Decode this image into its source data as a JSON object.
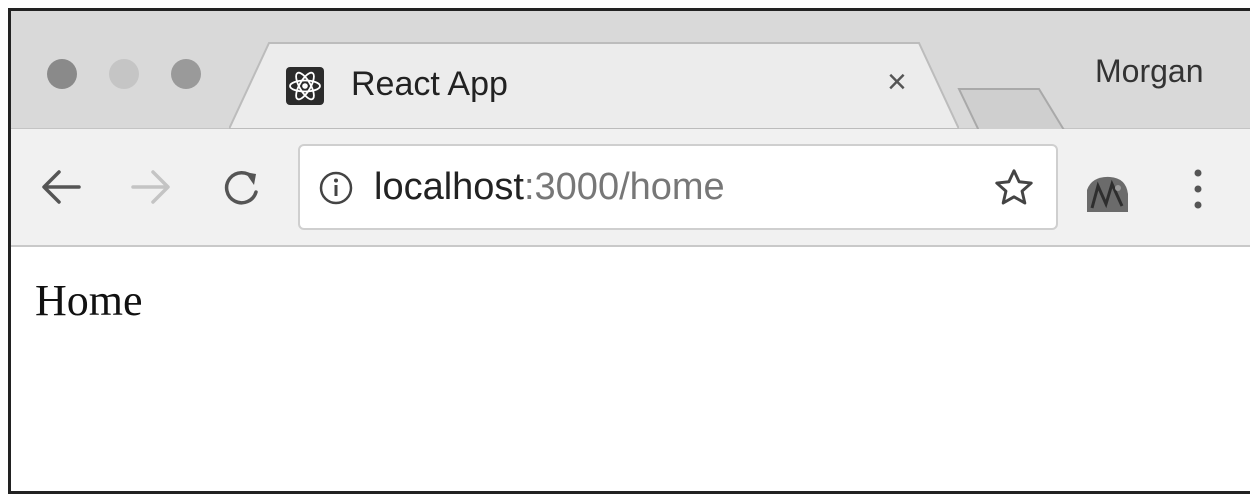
{
  "window": {
    "profile_name": "Morgan"
  },
  "tab": {
    "title": "React App",
    "favicon": "react-logo-icon",
    "close_glyph": "×"
  },
  "toolbar": {
    "back_icon": "back-arrow-icon",
    "forward_icon": "forward-arrow-icon",
    "reload_icon": "reload-icon",
    "address": {
      "host": "localhost",
      "rest": ":3000/home"
    },
    "info_icon": "info-icon",
    "bookmark_icon": "star-icon",
    "extension_icon": "extension-icon",
    "menu_icon": "vertical-dots-icon"
  },
  "page": {
    "heading": "Home"
  },
  "colors": {
    "titlebar": "#d9d9d9",
    "tab_active": "#ececec",
    "toolbar": "#f1f1f1",
    "text": "#222222",
    "url_muted": "#777777"
  }
}
